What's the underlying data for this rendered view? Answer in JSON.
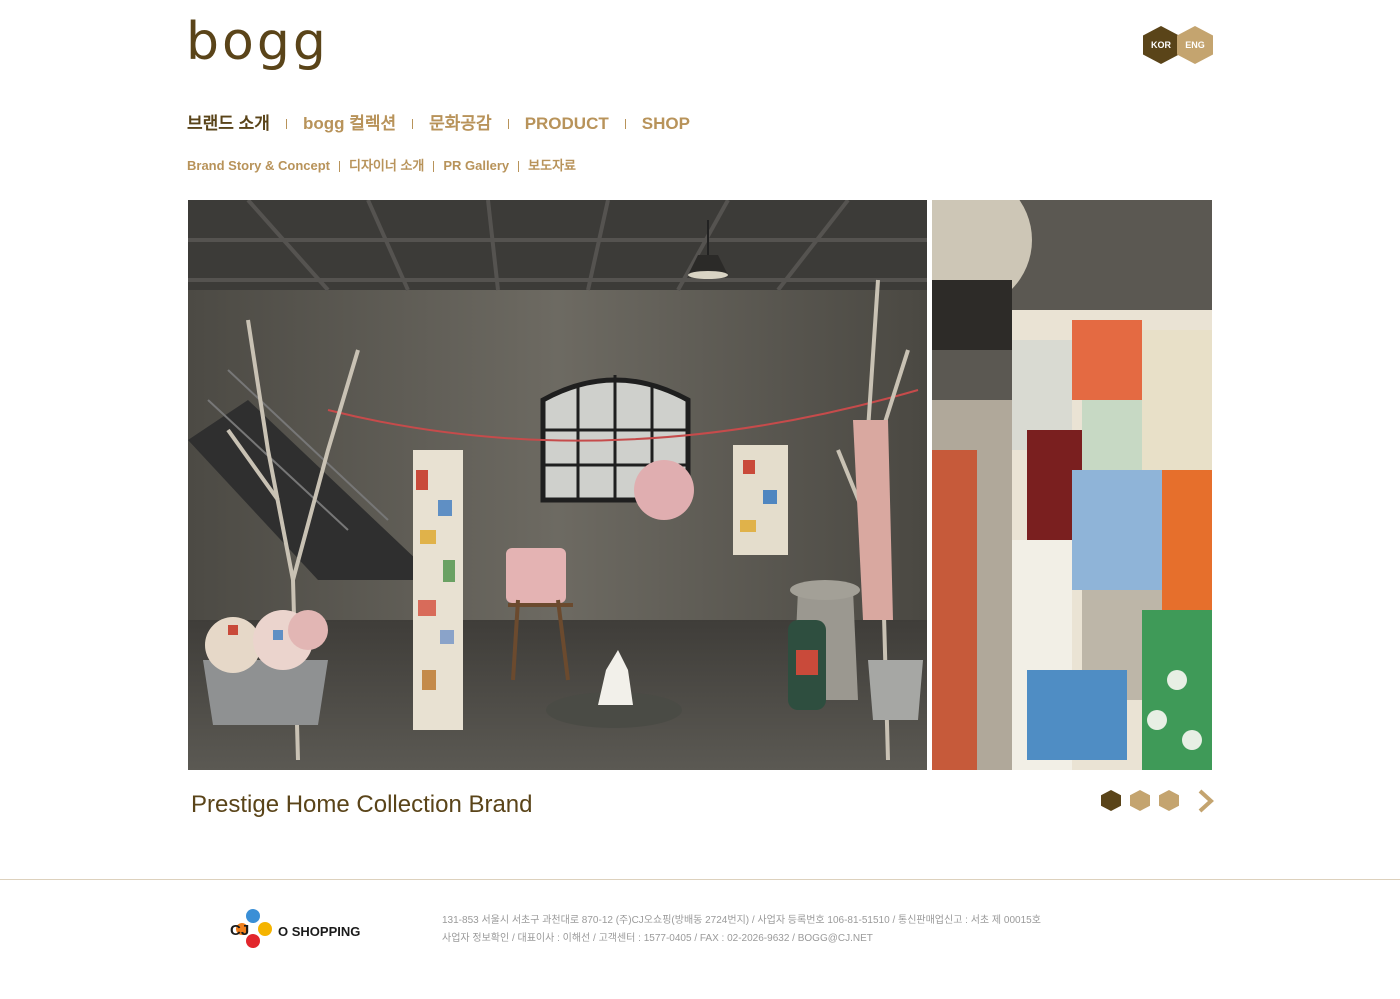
{
  "header": {
    "logo": "bogg",
    "lang": {
      "kor": "KOR",
      "eng": "ENG"
    }
  },
  "gnb": [
    "브랜드 소개",
    "bogg 컬렉션",
    "문화공감",
    "PRODUCT",
    "SHOP"
  ],
  "lnb": [
    "Brand Story & Concept",
    "디자이너 소개",
    "PR Gallery",
    "보도자료"
  ],
  "hero": {
    "tagline": "Prestige Home Collection Brand",
    "slide_count": 3,
    "active_slide": 1
  },
  "footer": {
    "company_logo_cj": "CJ",
    "company_logo_rest": "O SHOPPING",
    "line1": "131-853 서울시 서초구 과천대로 870-12 (주)CJ오쇼핑(방배동 2724번지) / 사업자 등록번호 106-81-51510 / 통신판매업신고 : 서초 제 00015호",
    "line2": "사업자 정보확인 / 대표이사 : 이해선 / 고객센터 : 1577-0405  / FAX : 02-2026-9632  / BOGG@CJ.NET"
  },
  "colors": {
    "brand_dark": "#5a4419",
    "brand_gold": "#c4a46f",
    "nav_gold": "#b8935a"
  }
}
